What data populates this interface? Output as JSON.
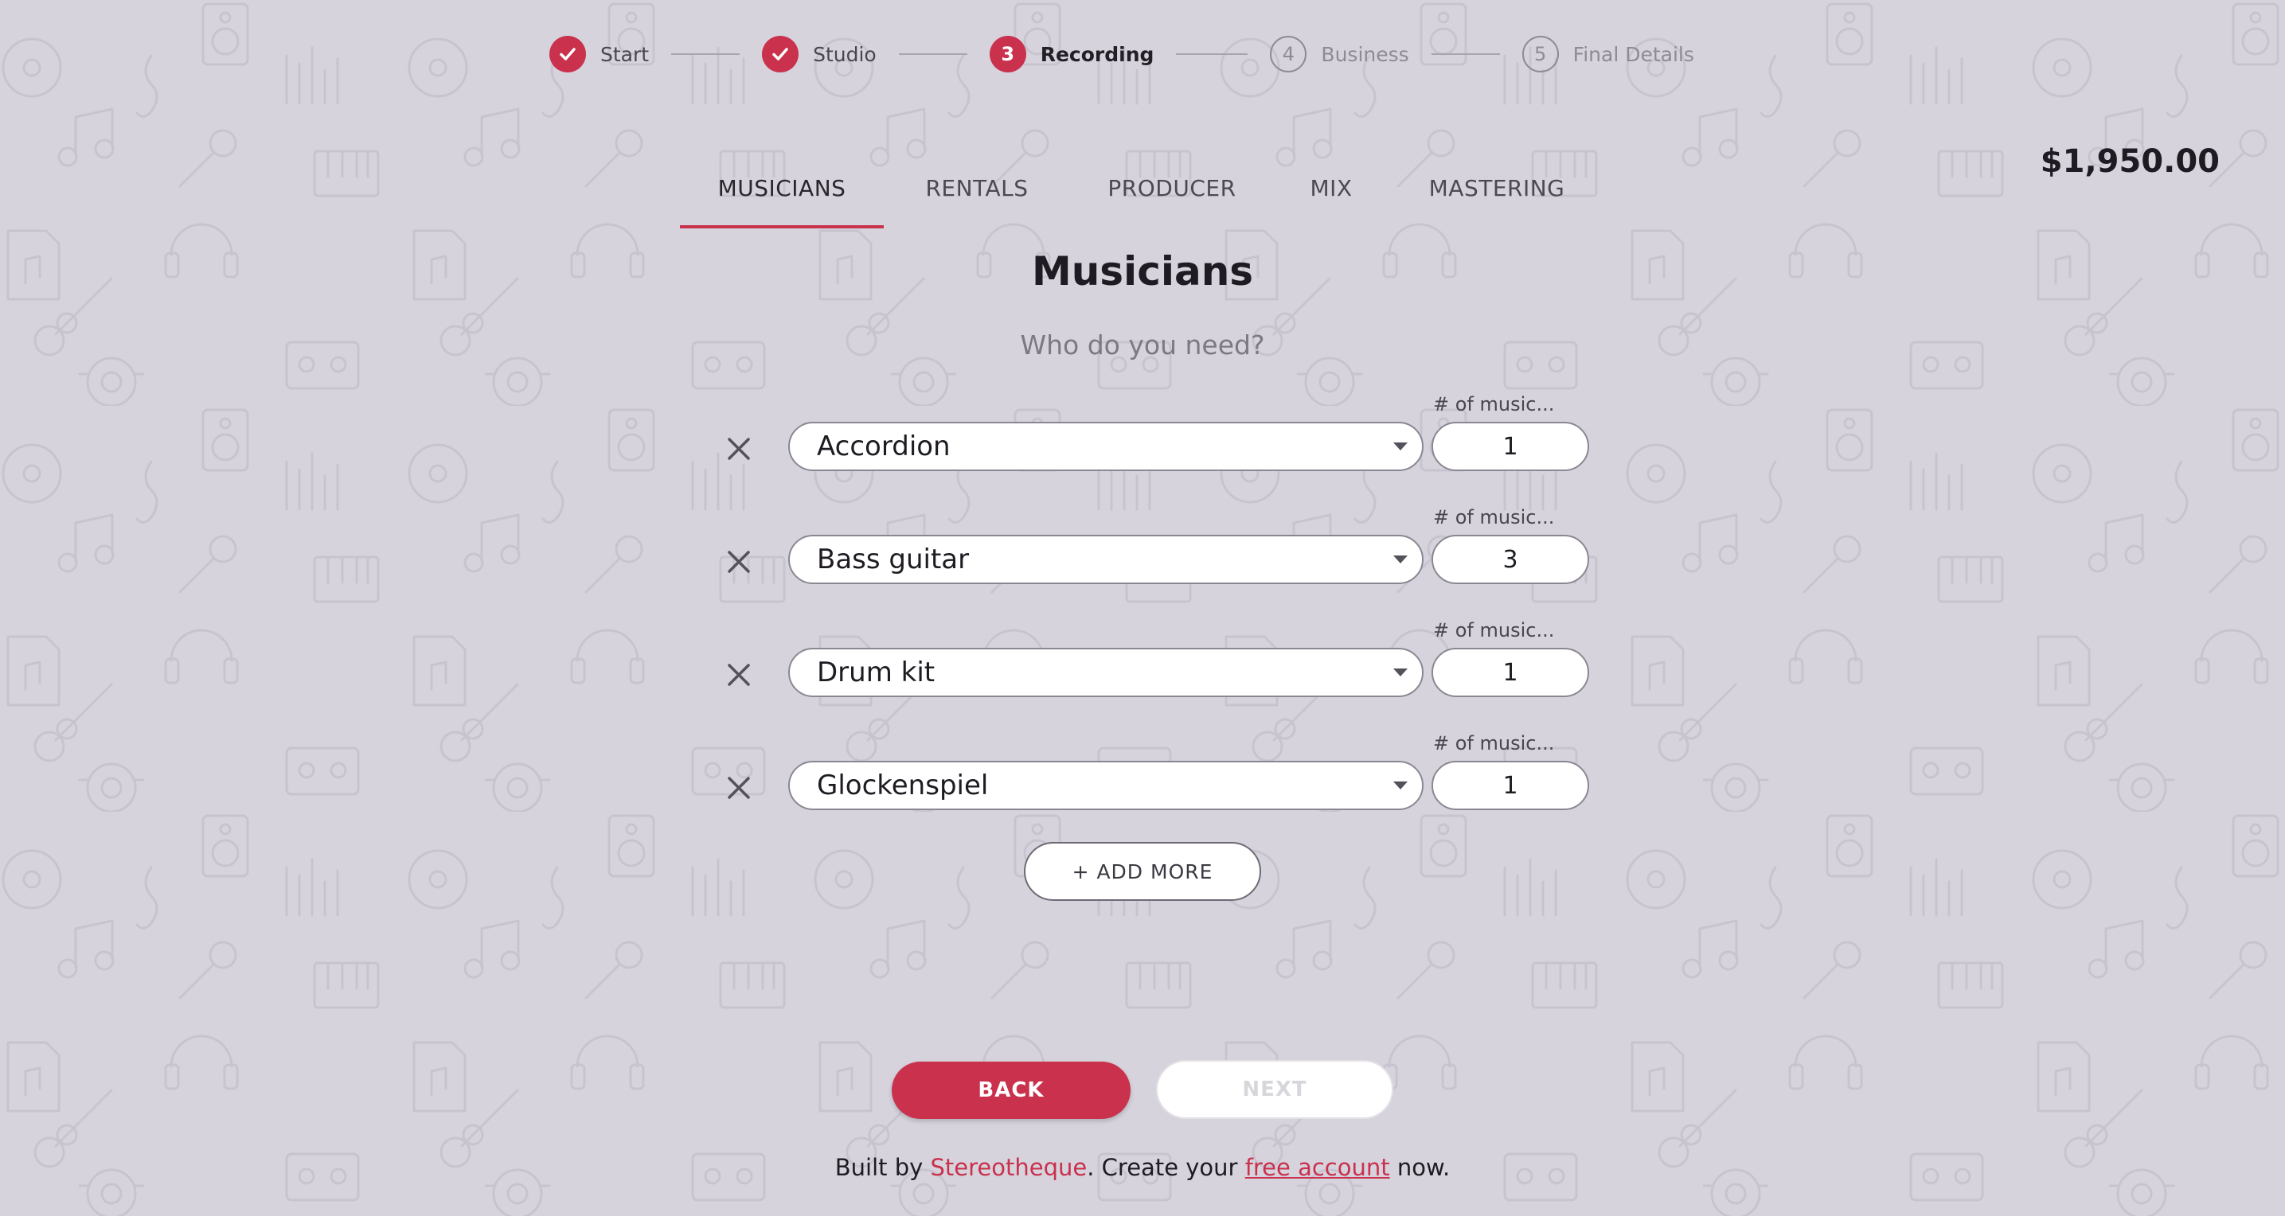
{
  "stepper": {
    "steps": [
      {
        "label": "Start",
        "number": "",
        "status": "done",
        "icon": "checkmark-icon"
      },
      {
        "label": "Studio",
        "number": "",
        "status": "done",
        "icon": "checkmark-icon"
      },
      {
        "label": "Recording",
        "number": "3",
        "status": "active"
      },
      {
        "label": "Business",
        "number": "4",
        "status": "todo"
      },
      {
        "label": "Final Details",
        "number": "5",
        "status": "todo"
      }
    ]
  },
  "price": "$1,950.00",
  "tabs": [
    {
      "label": "MUSICIANS",
      "active": true
    },
    {
      "label": "RENTALS",
      "active": false
    },
    {
      "label": "PRODUCER",
      "active": false
    },
    {
      "label": "MIX",
      "active": false
    },
    {
      "label": "MASTERING",
      "active": false
    }
  ],
  "section": {
    "title": "Musicians",
    "subtitle": "Who do you need?"
  },
  "musicians": [
    {
      "instrument": "Accordion",
      "count_label": "# of music...",
      "count": "1"
    },
    {
      "instrument": "Bass guitar",
      "count_label": "# of music...",
      "count": "3"
    },
    {
      "instrument": "Drum kit",
      "count_label": "# of music...",
      "count": "1"
    },
    {
      "instrument": "Glockenspiel",
      "count_label": "# of music...",
      "count": "1"
    }
  ],
  "add_more_label": "+ ADD MORE",
  "nav": {
    "back_label": "BACK",
    "next_label": "NEXT"
  },
  "footer": {
    "prefix": "Built by ",
    "brand_link": "Stereotheque",
    "middle": ". Create your ",
    "account_link": "free account",
    "suffix": " now."
  },
  "colors": {
    "accent": "#c9314d",
    "background": "#d6d3dc",
    "text": "#1f1b22",
    "muted": "#8f8b96"
  }
}
